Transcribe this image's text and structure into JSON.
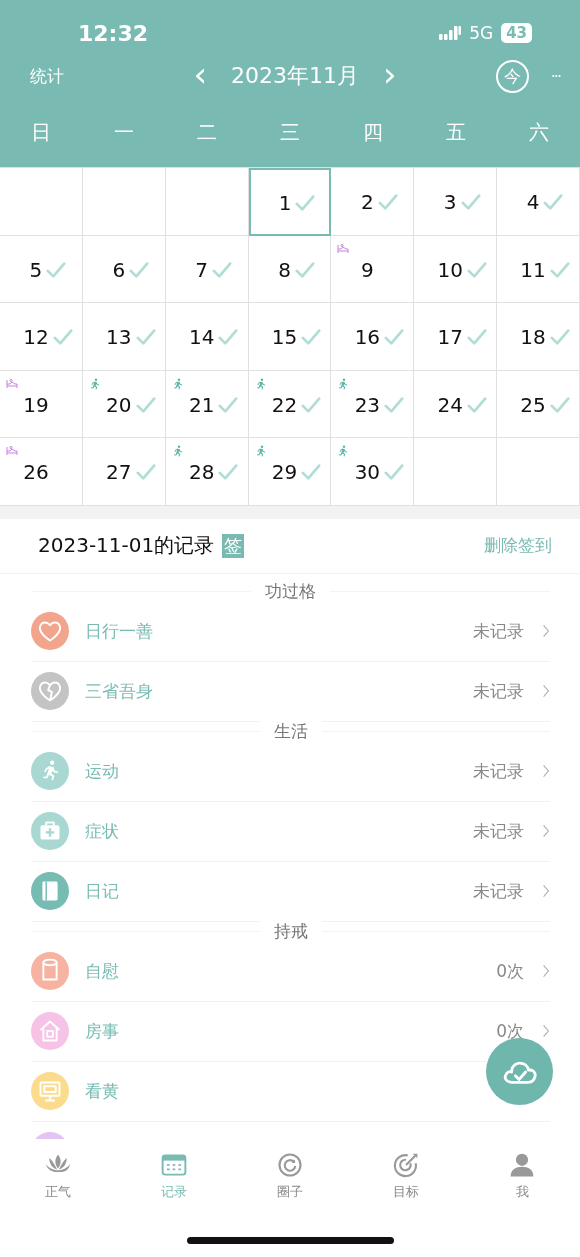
{
  "status_bar": {
    "time": "12:32",
    "network": "5G",
    "battery": "43"
  },
  "nav": {
    "left": "统计",
    "title": "2023年11月",
    "prev": "‹",
    "next": "›",
    "today": "今",
    "more": "···"
  },
  "weekdays": [
    "日",
    "一",
    "二",
    "三",
    "四",
    "五",
    "六"
  ],
  "calendar": [
    {
      "kind": "blank"
    },
    {
      "kind": "blank"
    },
    {
      "kind": "blank"
    },
    {
      "kind": "day",
      "day": "1",
      "checked": true,
      "selected": true
    },
    {
      "kind": "day",
      "day": "2",
      "checked": true,
      "selected": false
    },
    {
      "kind": "day",
      "day": "3",
      "checked": true,
      "selected": false
    },
    {
      "kind": "day",
      "day": "4",
      "checked": true,
      "selected": false
    },
    {
      "kind": "day",
      "day": "5",
      "checked": true,
      "selected": false
    },
    {
      "kind": "day",
      "day": "6",
      "checked": true,
      "selected": false
    },
    {
      "kind": "day",
      "day": "7",
      "checked": true,
      "selected": false
    },
    {
      "kind": "day",
      "day": "8",
      "checked": true,
      "selected": false
    },
    {
      "kind": "day",
      "day": "9",
      "checked": false,
      "selected": false,
      "marker": {
        "kind": "bed"
      }
    },
    {
      "kind": "day",
      "day": "10",
      "checked": true,
      "selected": false
    },
    {
      "kind": "day",
      "day": "11",
      "checked": true,
      "selected": false
    },
    {
      "kind": "day",
      "day": "12",
      "checked": true,
      "selected": false
    },
    {
      "kind": "day",
      "day": "13",
      "checked": true,
      "selected": false
    },
    {
      "kind": "day",
      "day": "14",
      "checked": true,
      "selected": false
    },
    {
      "kind": "day",
      "day": "15",
      "checked": true,
      "selected": false
    },
    {
      "kind": "day",
      "day": "16",
      "checked": true,
      "selected": false
    },
    {
      "kind": "day",
      "day": "17",
      "checked": true,
      "selected": false
    },
    {
      "kind": "day",
      "day": "18",
      "checked": true,
      "selected": false
    },
    {
      "kind": "day",
      "day": "19",
      "checked": false,
      "selected": false,
      "marker": {
        "kind": "bed"
      }
    },
    {
      "kind": "day",
      "day": "20",
      "checked": true,
      "selected": false,
      "marker": {
        "kind": "runner"
      }
    },
    {
      "kind": "day",
      "day": "21",
      "checked": true,
      "selected": false,
      "marker": {
        "kind": "runner"
      }
    },
    {
      "kind": "day",
      "day": "22",
      "checked": true,
      "selected": false,
      "marker": {
        "kind": "runner"
      }
    },
    {
      "kind": "day",
      "day": "23",
      "checked": true,
      "selected": false,
      "marker": {
        "kind": "runner"
      }
    },
    {
      "kind": "day",
      "day": "24",
      "checked": true,
      "selected": false
    },
    {
      "kind": "day",
      "day": "25",
      "checked": true,
      "selected": false
    },
    {
      "kind": "day",
      "day": "26",
      "checked": false,
      "selected": false,
      "marker": {
        "kind": "bed"
      }
    },
    {
      "kind": "day",
      "day": "27",
      "checked": true,
      "selected": false
    },
    {
      "kind": "day",
      "day": "28",
      "checked": true,
      "selected": false,
      "marker": {
        "kind": "runner"
      }
    },
    {
      "kind": "day",
      "day": "29",
      "checked": true,
      "selected": false,
      "marker": {
        "kind": "runner"
      }
    },
    {
      "kind": "day",
      "day": "30",
      "checked": true,
      "selected": false,
      "marker": {
        "kind": "runner"
      }
    },
    {
      "kind": "blank"
    },
    {
      "kind": "blank"
    }
  ],
  "record": {
    "title": "2023-11-01的记录",
    "badge": "签",
    "action": "删除签到"
  },
  "sections": [
    {
      "title": "功过格",
      "items": [
        {
          "label": "日行一善",
          "value": "未记录",
          "kind": "heart",
          "color": "#f2a58c"
        },
        {
          "label": "三省吾身",
          "value": "未记录",
          "kind": "broken-heart",
          "color": "#c4c4c4"
        }
      ]
    },
    {
      "title": "生活",
      "items": [
        {
          "label": "运动",
          "value": "未记录",
          "kind": "runner",
          "color": "#a9d8d3"
        },
        {
          "label": "症状",
          "value": "未记录",
          "kind": "medkit",
          "color": "#a9d8d3"
        },
        {
          "label": "日记",
          "value": "未记录",
          "kind": "book",
          "color": "#76bcb3"
        }
      ]
    },
    {
      "title": "持戒",
      "items": [
        {
          "label": "自慰",
          "value": "0次",
          "kind": "roll",
          "color": "#f7b3a2"
        },
        {
          "label": "房事",
          "value": "0次",
          "kind": "house",
          "color": "#f6c3e6"
        },
        {
          "label": "看黄",
          "kind": "monitor",
          "color": "#fbdc8e"
        },
        {
          "kind": "plain",
          "color": "#e3c4f2"
        }
      ]
    }
  ],
  "tabs": [
    {
      "label": "正气",
      "kind": "lotus",
      "selected": false
    },
    {
      "label": "记录",
      "kind": "calendar",
      "selected": true
    },
    {
      "label": "圈子",
      "kind": "circle",
      "selected": false
    },
    {
      "label": "目标",
      "kind": "target",
      "selected": false
    },
    {
      "label": "我",
      "kind": "person",
      "selected": false
    }
  ]
}
